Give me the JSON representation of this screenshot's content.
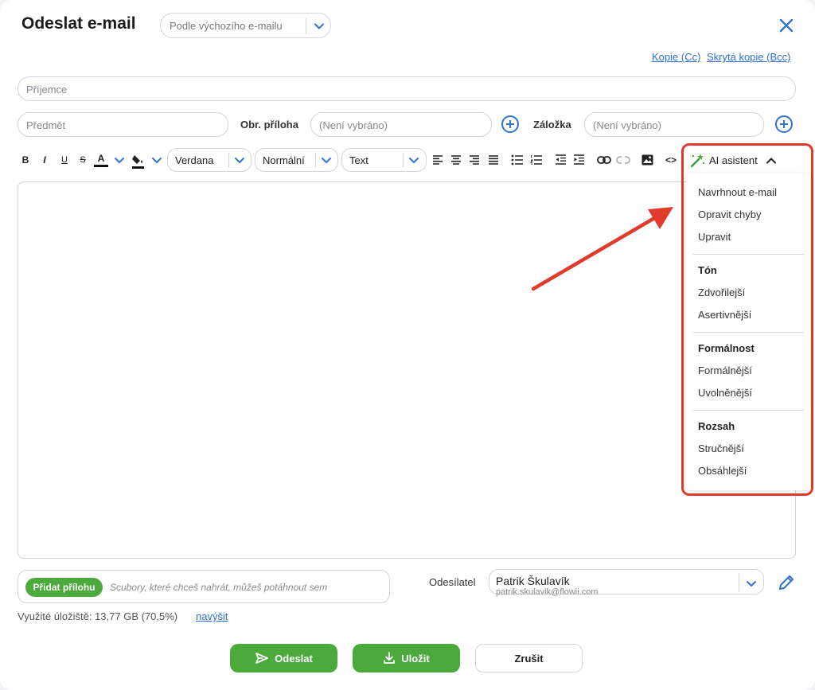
{
  "title": "Odeslat e-mail",
  "template_select": {
    "value": "Podle výchozího e-mailu"
  },
  "links": {
    "cc": "Kopie (Cc)",
    "bcc": "Skrytá kopie (Bcc)"
  },
  "fields": {
    "recipient_placeholder": "Příjemce",
    "subject_placeholder": "Předmět",
    "image_attachment_label": "Obr. příloha",
    "image_attachment_value": "(Není vybráno)",
    "bookmark_label": "Záložka",
    "bookmark_value": "(Není vybráno)"
  },
  "toolbar": {
    "bold": "B",
    "italic": "I",
    "underline": "U",
    "strike": "S",
    "font_color": "A",
    "font": "Verdana",
    "size": "Normální",
    "format": "Text",
    "source": "<>"
  },
  "ai": {
    "label": "AI asistent",
    "items": [
      "Navrhnout e-mail",
      "Opravit chyby",
      "Upravit"
    ],
    "tone_heading": "Tón",
    "tone_items": [
      "Zdvořilejší",
      "Asertivnější"
    ],
    "formality_heading": "Formálnost",
    "formality_items": [
      "Formálnější",
      "Uvolněnější"
    ],
    "scope_heading": "Rozsah",
    "scope_items": [
      "Stručnější",
      "Obsáhlejší"
    ]
  },
  "attachment": {
    "button": "Přidat přílohu",
    "hint": "Scubory, které chceš nahrát, můžeš potáhnout sem"
  },
  "storage": {
    "text": "Využité úložiště: 13,77 GB (70,5%)",
    "link": "navýšit"
  },
  "sender": {
    "label": "Odesílatel",
    "name": "Patrik Škulavík",
    "email": "patrik.skulavik@flowii.com"
  },
  "buttons": {
    "send": "Odeslat",
    "save": "Uložit",
    "cancel": "Zrušit"
  },
  "colors": {
    "accent": "#2f74d0",
    "green": "#4caa3c",
    "highlight": "#e03b2b"
  }
}
